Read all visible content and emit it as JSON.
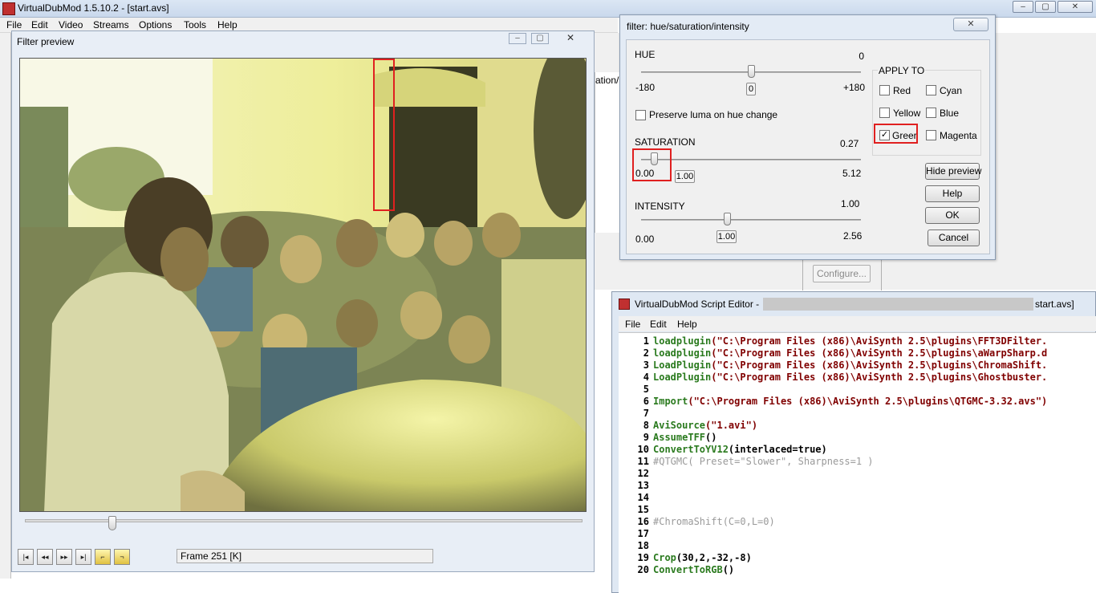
{
  "app": {
    "title": "VirtualDubMod 1.5.10.2 - [start.avs]",
    "menu": [
      "File",
      "Edit",
      "Video",
      "Streams",
      "Options",
      "Tools",
      "Help"
    ],
    "bg_fragment": "ation/ir",
    "configure_label": "Configure..."
  },
  "preview": {
    "title": "Filter preview",
    "frame_label": "Frame 251 [K]",
    "seek_position": 0.155
  },
  "filter_dialog": {
    "title": "filter: hue/saturation/intensity",
    "close_label": "✕",
    "hue": {
      "label": "HUE",
      "value": "0",
      "min": "-180",
      "max": "+180",
      "box": "0",
      "position": 0.5
    },
    "preserve_luma": {
      "label": "Preserve luma on hue change",
      "checked": false
    },
    "saturation": {
      "label": "SATURATION",
      "value": "0.27",
      "min": "0.00",
      "max": "5.12",
      "box": "1.00",
      "position": 0.06
    },
    "intensity": {
      "label": "INTENSITY",
      "value": "1.00",
      "min": "0.00",
      "max": "2.56",
      "box": "1.00",
      "position": 0.39
    },
    "apply_to": {
      "label": "APPLY TO",
      "items": [
        {
          "label": "Red",
          "checked": false
        },
        {
          "label": "Cyan",
          "checked": false
        },
        {
          "label": "Yellow",
          "checked": false
        },
        {
          "label": "Blue",
          "checked": false
        },
        {
          "label": "Greer",
          "checked": true
        },
        {
          "label": "Magenta",
          "checked": false
        }
      ]
    },
    "buttons": {
      "hide_preview": "Hide preview",
      "help": "Help",
      "ok": "OK",
      "cancel": "Cancel"
    }
  },
  "script_editor": {
    "title_prefix": "VirtualDubMod Script Editor - ",
    "filename": "start.avs]",
    "menu": [
      "File",
      "Edit",
      "Help"
    ],
    "lines": [
      {
        "n": "1",
        "kw": "loadplugin",
        "rest": "(\"C:\\Program Files (x86)\\AviSynth 2.5\\plugins\\FFT3DFilter.",
        "type": "plugin"
      },
      {
        "n": "2",
        "kw": "loadplugin",
        "rest": "(\"C:\\Program Files (x86)\\AviSynth 2.5\\plugins\\aWarpSharp.d",
        "type": "plugin"
      },
      {
        "n": "3",
        "kw": "LoadPlugin",
        "rest": "(\"C:\\Program Files (x86)\\AviSynth 2.5\\plugins\\ChromaShift.",
        "type": "plugin"
      },
      {
        "n": "4",
        "kw": "LoadPlugin",
        "rest": "(\"C:\\Program Files (x86)\\AviSynth 2.5\\plugins\\Ghostbuster.",
        "type": "plugin"
      },
      {
        "n": "5",
        "kw": "",
        "rest": "",
        "type": "plain"
      },
      {
        "n": "6",
        "kw": "Import",
        "rest": "(\"C:\\Program Files (x86)\\AviSynth 2.5\\plugins\\QTGMC-3.32.avs\")",
        "type": "import"
      },
      {
        "n": "7",
        "kw": "",
        "rest": "",
        "type": "plain"
      },
      {
        "n": "8",
        "kw": "AviSource",
        "rest": "(\"1.avi\")",
        "type": "import"
      },
      {
        "n": "9",
        "kw": "AssumeTFF",
        "rest": "()",
        "type": "plain"
      },
      {
        "n": "10",
        "kw": "ConvertToYV12",
        "rest": "(interlaced=true)",
        "type": "plain"
      },
      {
        "n": "11",
        "kw": "",
        "rest": "#QTGMC( Preset=\"Slower\", Sharpness=1 )",
        "type": "comment"
      },
      {
        "n": "12",
        "kw": "",
        "rest": "",
        "type": "plain"
      },
      {
        "n": "13",
        "kw": "",
        "rest": "",
        "type": "plain"
      },
      {
        "n": "14",
        "kw": "",
        "rest": "",
        "type": "plain"
      },
      {
        "n": "15",
        "kw": "",
        "rest": "",
        "type": "plain"
      },
      {
        "n": "16",
        "kw": "",
        "rest": "#ChromaShift(C=0,L=0)",
        "type": "comment"
      },
      {
        "n": "17",
        "kw": "",
        "rest": "",
        "type": "plain"
      },
      {
        "n": "18",
        "kw": "",
        "rest": "",
        "type": "plain"
      },
      {
        "n": "19",
        "kw": "Crop",
        "rest": "(30,2,-32,-8)",
        "type": "plain"
      },
      {
        "n": "20",
        "kw": "ConvertToRGB",
        "rest": "()",
        "type": "plain"
      }
    ]
  },
  "colors": {
    "highlight_box": "#e02020",
    "keyword": "#2a7a1e",
    "string": "#800000",
    "comment": "#9a9a9a"
  }
}
